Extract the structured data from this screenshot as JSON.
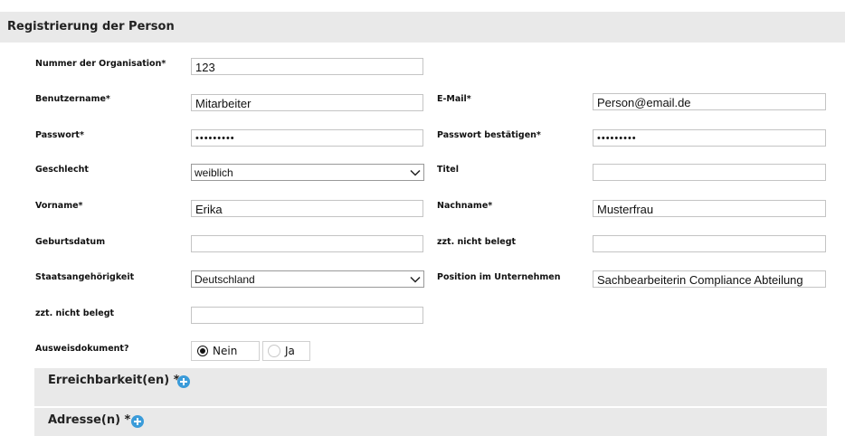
{
  "header": {
    "title": "Registrierung der Person"
  },
  "form": {
    "org_number": {
      "label": "Nummer der Organisation*",
      "value": "123"
    },
    "username": {
      "label": "Benutzername*",
      "value": "Mitarbeiter"
    },
    "email": {
      "label": "E-Mail*",
      "value": "Person@email.de"
    },
    "password": {
      "label": "Passwort*",
      "value": "•••••••••"
    },
    "password_confirm": {
      "label": "Passwort bestätigen*",
      "value": "•••••••••"
    },
    "gender": {
      "label": "Geschlecht",
      "value": "weiblich"
    },
    "title": {
      "label": "Titel",
      "value": ""
    },
    "first_name": {
      "label": "Vorname*",
      "value": "Erika"
    },
    "last_name": {
      "label": "Nachname*",
      "value": "Musterfrau"
    },
    "birthdate": {
      "label": "Geburtsdatum",
      "value": ""
    },
    "unused_1": {
      "label": "zzt. nicht belegt",
      "value": ""
    },
    "nationality": {
      "label": "Staatsangehörigkeit",
      "value": "Deutschland"
    },
    "position": {
      "label": "Position im Unternehmen",
      "value": "Sachbearbeiterin Compliance Abteilung"
    },
    "unused_2": {
      "label": "zzt. nicht belegt",
      "value": ""
    },
    "id_document": {
      "label": "Ausweisdokument?",
      "options": [
        "Nein",
        "Ja"
      ],
      "selected": "Nein"
    }
  },
  "sections": {
    "reachability": {
      "title": "Erreichbarkeit(en) *",
      "icon": "plus-circle-icon"
    },
    "address": {
      "title": "Adresse(n) *",
      "icon": "plus-circle-icon"
    }
  },
  "colors": {
    "accent": "#3a9bd9",
    "panel": "#e9e9e9",
    "border": "#c4c4c4"
  }
}
